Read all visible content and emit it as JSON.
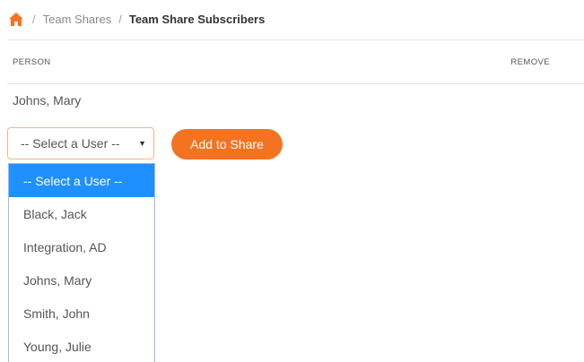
{
  "breadcrumb": {
    "home_icon": "home-icon",
    "separator": "/",
    "items": [
      {
        "label": "Team Shares"
      },
      {
        "label": "Team Share Subscribers"
      }
    ]
  },
  "table": {
    "headers": {
      "person": "PERSON",
      "remove": "REMOVE"
    },
    "rows": [
      {
        "name": "Johns, Mary"
      }
    ]
  },
  "select": {
    "value": "-- Select a User --",
    "options": [
      {
        "label": "-- Select a User --",
        "selected": true
      },
      {
        "label": "Black, Jack"
      },
      {
        "label": "Integration, AD"
      },
      {
        "label": "Johns, Mary"
      },
      {
        "label": "Smith, John"
      },
      {
        "label": "Young, Julie"
      }
    ]
  },
  "actions": {
    "add_label": "Add to Share"
  },
  "colors": {
    "accent": "#f47321",
    "selected_option": "#1e90ff"
  }
}
